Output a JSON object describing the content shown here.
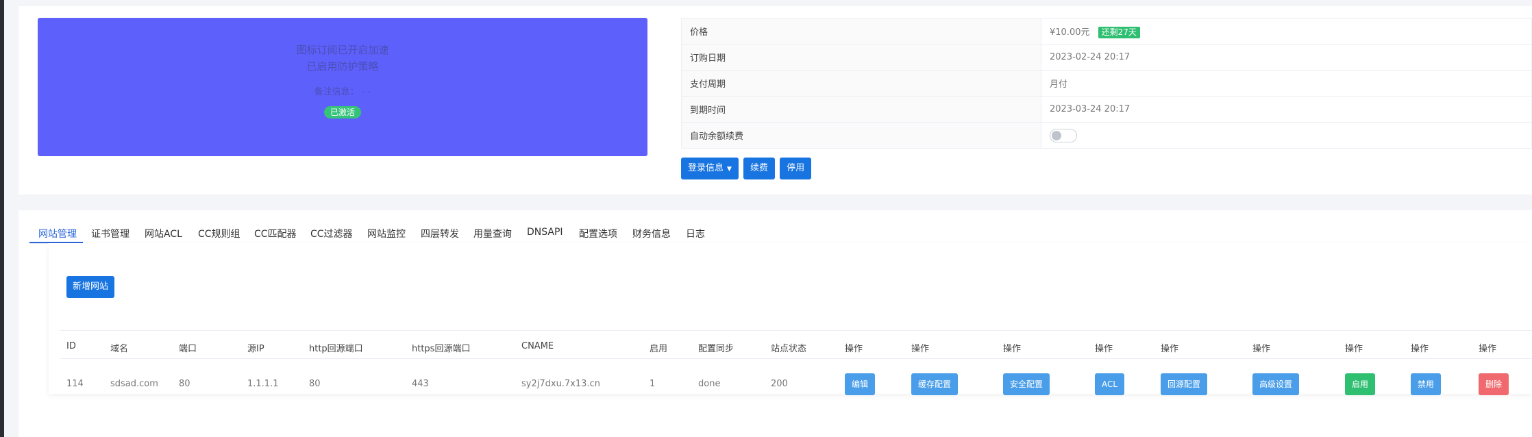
{
  "banner": {
    "line1": "图标订阅已开启加速",
    "line2": "已启用防护策略",
    "remark_label": "备注信息：",
    "remark_value": "- -",
    "status": "已激活"
  },
  "info": {
    "price_label": "价格",
    "price_value": "¥10.00元",
    "remaining": "还剩27天",
    "order_date_label": "订购日期",
    "order_date": "2023-02-24 20:17",
    "cycle_label": "支付周期",
    "cycle": "月付",
    "expire_label": "到期时间",
    "expire": "2023-03-24 20:17",
    "auto_renew_label": "自动余额续费"
  },
  "actions": {
    "login_info": "登录信息",
    "renew": "续费",
    "disable": "停用"
  },
  "tabs": [
    "网站管理",
    "证书管理",
    "网站ACL",
    "CC规则组",
    "CC匹配器",
    "CC过滤器",
    "网站监控",
    "四层转发",
    "用量查询",
    "DNSAPI",
    "配置选项",
    "财务信息",
    "日志"
  ],
  "site_table": {
    "add_button": "新增网站",
    "headers": [
      "ID",
      "域名",
      "端口",
      "源IP",
      "http回源端口",
      "https回源端口",
      "CNAME",
      "启用",
      "配置同步",
      "站点状态",
      "操作",
      "操作",
      "操作",
      "操作",
      "操作",
      "操作",
      "操作",
      "操作",
      "操作"
    ],
    "row": {
      "id": "114",
      "domain": "sdsad.com",
      "port": "80",
      "source_ip": "1.1.1.1",
      "http_port": "80",
      "https_port": "443",
      "cname": "sy2j7dxu.7x13.cn",
      "enabled": "1",
      "sync": "done",
      "status": "200"
    },
    "ops": {
      "edit": "编辑",
      "cache": "缓存配置",
      "security": "安全配置",
      "acl": "ACL",
      "origin": "回源配置",
      "advanced": "高级设置",
      "enable": "启用",
      "disable": "禁用",
      "delete": "删除"
    }
  },
  "colors": {
    "primary": "#1874e0",
    "banner": "#5e60fb",
    "success": "#2fbf71",
    "danger": "#f0696e",
    "op_blue": "#4a9ee9"
  }
}
